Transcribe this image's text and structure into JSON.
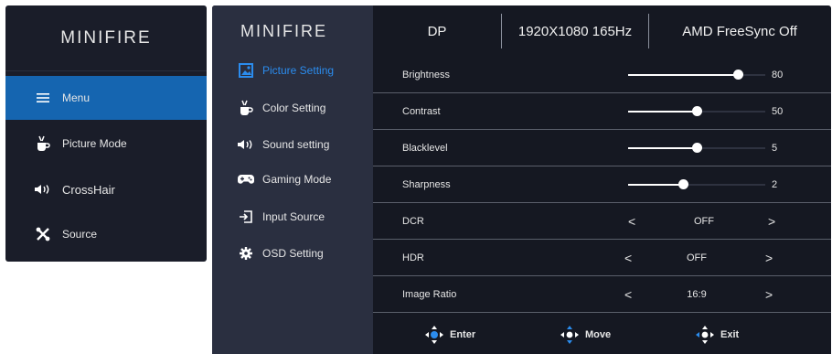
{
  "brand": "MINIFIRE",
  "quick_menu": {
    "items": [
      {
        "label": "Menu",
        "icon": "menu-icon",
        "active": true
      },
      {
        "label": "Picture Mode",
        "icon": "picture-mode-icon",
        "active": false
      },
      {
        "label": "CrossHair",
        "icon": "speaker-icon",
        "active": false
      },
      {
        "label": "Source",
        "icon": "tools-icon",
        "active": false
      }
    ]
  },
  "sidebar": {
    "items": [
      {
        "label": "Picture Setting",
        "icon": "picture-icon",
        "active": true
      },
      {
        "label": "Color Setting",
        "icon": "color-icon",
        "active": false
      },
      {
        "label": "Sound setting",
        "icon": "speaker-icon",
        "active": false
      },
      {
        "label": "Gaming Mode",
        "icon": "gamepad-icon",
        "active": false
      },
      {
        "label": "Input Source",
        "icon": "input-icon",
        "active": false
      },
      {
        "label": "OSD Setting",
        "icon": "gear-icon",
        "active": false
      }
    ]
  },
  "status": {
    "port": "DP",
    "resolution": "1920X1080 165Hz",
    "freesync": "AMD FreeSync Off"
  },
  "settings": {
    "brightness": {
      "label": "Brightness",
      "value": "80",
      "max": 100
    },
    "contrast": {
      "label": "Contrast",
      "value": "50",
      "max": 100
    },
    "blacklevel": {
      "label": "Blacklevel",
      "value": "5",
      "max": 10
    },
    "sharpness": {
      "label": "Sharpness",
      "value": "2",
      "max": 5
    },
    "dcr": {
      "label": "DCR",
      "value": "OFF"
    },
    "hdr": {
      "label": "HDR",
      "value": "OFF"
    },
    "image_ratio": {
      "label": "Image Ratio",
      "value": "16:9"
    }
  },
  "arrows": {
    "left": "<",
    "right": ">"
  },
  "footer": {
    "enter": "Enter",
    "move": "Move",
    "exit": "Exit"
  },
  "colors": {
    "accent": "#2b8cee",
    "active_bg": "#1565b0",
    "panel": "#151822",
    "sidebar": "#2a2f40"
  }
}
